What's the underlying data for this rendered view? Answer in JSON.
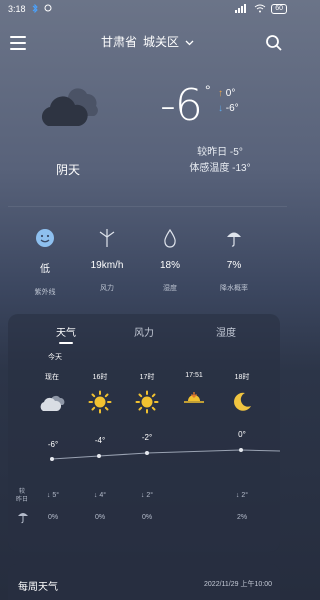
{
  "status_bar": {
    "time": "3:18",
    "battery": "60"
  },
  "header": {
    "province": "甘肃省",
    "district": "城关区"
  },
  "current": {
    "temperature": "-6",
    "degree_symbol": "°",
    "high": "0°",
    "low": "-6°",
    "condition": "阴天",
    "compare_yesterday": "较昨日 -5°",
    "feels_like": "体感温度 -13°"
  },
  "metrics": [
    {
      "value": "低",
      "label": "紫外线",
      "icon": "uv-face-icon"
    },
    {
      "value": "19km/h",
      "label": "风力",
      "icon": "wind-turbine-icon"
    },
    {
      "value": "18%",
      "label": "湿度",
      "icon": "droplet-icon"
    },
    {
      "value": "7%",
      "label": "降水概率",
      "icon": "umbrella-icon"
    }
  ],
  "forecast_card": {
    "tabs": [
      "天气",
      "风力",
      "湿度"
    ],
    "active_tab": 0,
    "today_label": "今天",
    "hours": [
      {
        "time": "现在",
        "icon": "cloudy-icon",
        "temp": "-6°",
        "temp_value": -6,
        "wind": "↓ 5°",
        "rain": "0%"
      },
      {
        "time": "16时",
        "icon": "sun-icon",
        "temp": "-4°",
        "temp_value": -4,
        "wind": "↓ 4°",
        "rain": "0%"
      },
      {
        "time": "17时",
        "icon": "sun-icon",
        "temp": "-2°",
        "temp_value": -2,
        "wind": "↓ 2°",
        "rain": "0%"
      },
      {
        "time": "17:51",
        "icon": "sunset-icon",
        "temp": "",
        "temp_value": null,
        "wind": "",
        "rain": ""
      },
      {
        "time": "18时",
        "icon": "moon-icon",
        "temp": "0°",
        "temp_value": 0,
        "wind": "↓ 2°",
        "rain": "2%"
      }
    ],
    "row_labels": {
      "yesterday_compare": [
        "较",
        "昨日"
      ],
      "rain_icon": "umbrella-icon"
    }
  },
  "weekly": {
    "title": "每周天气",
    "updated": "2022/11/29 上午10:00"
  },
  "colors": {
    "accent_high": "#e8a44d",
    "accent_low": "#5ea8e8",
    "sun": "#f2c230",
    "moon": "#f0c440"
  }
}
